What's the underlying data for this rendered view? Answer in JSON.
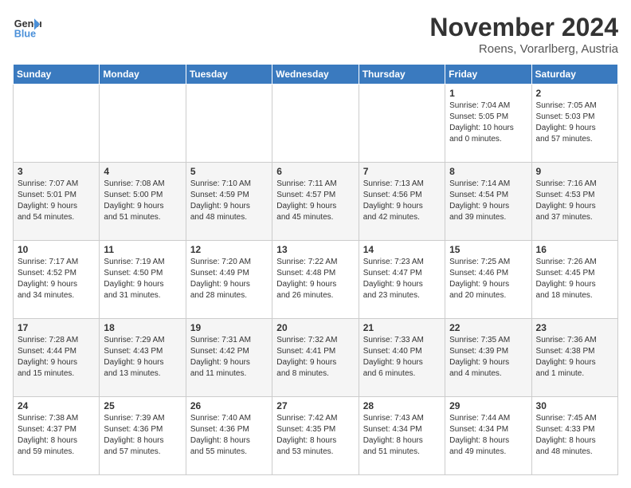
{
  "logo": {
    "line1": "General",
    "line2": "Blue"
  },
  "title": "November 2024",
  "location": "Roens, Vorarlberg, Austria",
  "weekdays": [
    "Sunday",
    "Monday",
    "Tuesday",
    "Wednesday",
    "Thursday",
    "Friday",
    "Saturday"
  ],
  "weeks": [
    [
      {
        "day": "",
        "info": ""
      },
      {
        "day": "",
        "info": ""
      },
      {
        "day": "",
        "info": ""
      },
      {
        "day": "",
        "info": ""
      },
      {
        "day": "",
        "info": ""
      },
      {
        "day": "1",
        "info": "Sunrise: 7:04 AM\nSunset: 5:05 PM\nDaylight: 10 hours\nand 0 minutes."
      },
      {
        "day": "2",
        "info": "Sunrise: 7:05 AM\nSunset: 5:03 PM\nDaylight: 9 hours\nand 57 minutes."
      }
    ],
    [
      {
        "day": "3",
        "info": "Sunrise: 7:07 AM\nSunset: 5:01 PM\nDaylight: 9 hours\nand 54 minutes."
      },
      {
        "day": "4",
        "info": "Sunrise: 7:08 AM\nSunset: 5:00 PM\nDaylight: 9 hours\nand 51 minutes."
      },
      {
        "day": "5",
        "info": "Sunrise: 7:10 AM\nSunset: 4:59 PM\nDaylight: 9 hours\nand 48 minutes."
      },
      {
        "day": "6",
        "info": "Sunrise: 7:11 AM\nSunset: 4:57 PM\nDaylight: 9 hours\nand 45 minutes."
      },
      {
        "day": "7",
        "info": "Sunrise: 7:13 AM\nSunset: 4:56 PM\nDaylight: 9 hours\nand 42 minutes."
      },
      {
        "day": "8",
        "info": "Sunrise: 7:14 AM\nSunset: 4:54 PM\nDaylight: 9 hours\nand 39 minutes."
      },
      {
        "day": "9",
        "info": "Sunrise: 7:16 AM\nSunset: 4:53 PM\nDaylight: 9 hours\nand 37 minutes."
      }
    ],
    [
      {
        "day": "10",
        "info": "Sunrise: 7:17 AM\nSunset: 4:52 PM\nDaylight: 9 hours\nand 34 minutes."
      },
      {
        "day": "11",
        "info": "Sunrise: 7:19 AM\nSunset: 4:50 PM\nDaylight: 9 hours\nand 31 minutes."
      },
      {
        "day": "12",
        "info": "Sunrise: 7:20 AM\nSunset: 4:49 PM\nDaylight: 9 hours\nand 28 minutes."
      },
      {
        "day": "13",
        "info": "Sunrise: 7:22 AM\nSunset: 4:48 PM\nDaylight: 9 hours\nand 26 minutes."
      },
      {
        "day": "14",
        "info": "Sunrise: 7:23 AM\nSunset: 4:47 PM\nDaylight: 9 hours\nand 23 minutes."
      },
      {
        "day": "15",
        "info": "Sunrise: 7:25 AM\nSunset: 4:46 PM\nDaylight: 9 hours\nand 20 minutes."
      },
      {
        "day": "16",
        "info": "Sunrise: 7:26 AM\nSunset: 4:45 PM\nDaylight: 9 hours\nand 18 minutes."
      }
    ],
    [
      {
        "day": "17",
        "info": "Sunrise: 7:28 AM\nSunset: 4:44 PM\nDaylight: 9 hours\nand 15 minutes."
      },
      {
        "day": "18",
        "info": "Sunrise: 7:29 AM\nSunset: 4:43 PM\nDaylight: 9 hours\nand 13 minutes."
      },
      {
        "day": "19",
        "info": "Sunrise: 7:31 AM\nSunset: 4:42 PM\nDaylight: 9 hours\nand 11 minutes."
      },
      {
        "day": "20",
        "info": "Sunrise: 7:32 AM\nSunset: 4:41 PM\nDaylight: 9 hours\nand 8 minutes."
      },
      {
        "day": "21",
        "info": "Sunrise: 7:33 AM\nSunset: 4:40 PM\nDaylight: 9 hours\nand 6 minutes."
      },
      {
        "day": "22",
        "info": "Sunrise: 7:35 AM\nSunset: 4:39 PM\nDaylight: 9 hours\nand 4 minutes."
      },
      {
        "day": "23",
        "info": "Sunrise: 7:36 AM\nSunset: 4:38 PM\nDaylight: 9 hours\nand 1 minute."
      }
    ],
    [
      {
        "day": "24",
        "info": "Sunrise: 7:38 AM\nSunset: 4:37 PM\nDaylight: 8 hours\nand 59 minutes."
      },
      {
        "day": "25",
        "info": "Sunrise: 7:39 AM\nSunset: 4:36 PM\nDaylight: 8 hours\nand 57 minutes."
      },
      {
        "day": "26",
        "info": "Sunrise: 7:40 AM\nSunset: 4:36 PM\nDaylight: 8 hours\nand 55 minutes."
      },
      {
        "day": "27",
        "info": "Sunrise: 7:42 AM\nSunset: 4:35 PM\nDaylight: 8 hours\nand 53 minutes."
      },
      {
        "day": "28",
        "info": "Sunrise: 7:43 AM\nSunset: 4:34 PM\nDaylight: 8 hours\nand 51 minutes."
      },
      {
        "day": "29",
        "info": "Sunrise: 7:44 AM\nSunset: 4:34 PM\nDaylight: 8 hours\nand 49 minutes."
      },
      {
        "day": "30",
        "info": "Sunrise: 7:45 AM\nSunset: 4:33 PM\nDaylight: 8 hours\nand 48 minutes."
      }
    ]
  ]
}
